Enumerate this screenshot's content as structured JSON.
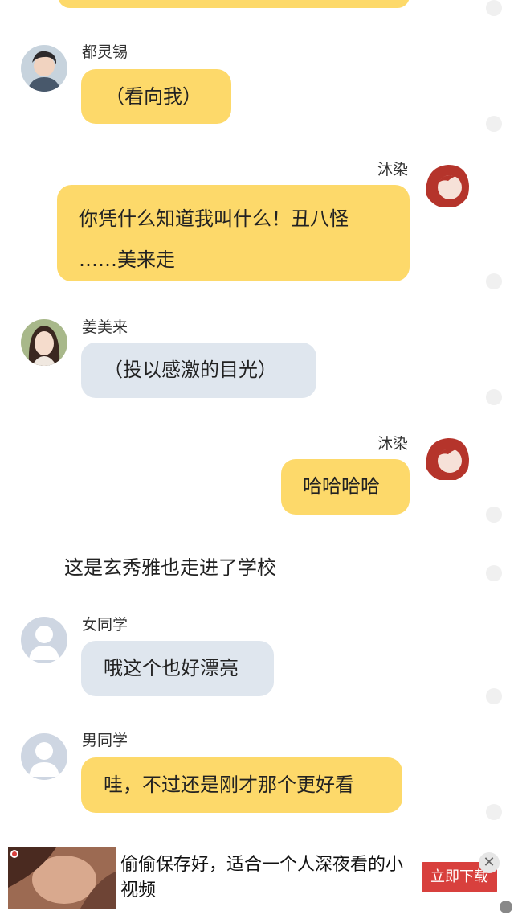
{
  "messages": [
    {
      "sender": "都灵锡",
      "side": "left",
      "text": "（看向我）",
      "color": "#fdd96a"
    },
    {
      "sender": "沐染",
      "side": "right",
      "text_line1": "你凭什么知道我叫什么！丑八怪",
      "text_line2": "……美来走",
      "color": "#fdd96a"
    },
    {
      "sender": "姜美来",
      "side": "left",
      "text": "（投以感激的目光）",
      "color": "#dfe6ee"
    },
    {
      "sender": "沐染",
      "side": "right",
      "text": "哈哈哈哈",
      "color": "#fdd96a"
    },
    {
      "sender": "女同学",
      "side": "left",
      "text": "哦这个也好漂亮",
      "color": "#dfe6ee"
    },
    {
      "sender": "男同学",
      "side": "left",
      "text": "哇，不过还是刚才那个更好看",
      "color": "#fdd96a"
    }
  ],
  "narration": "这是玄秀雅也走进了学校",
  "ad": {
    "text": "偷偷保存好，适合一个人深夜看的小视频",
    "button_label": "立即下载",
    "close_icon": "✕"
  },
  "colors": {
    "bubble_yellow": "#fdd96a",
    "bubble_grey": "#dfe6ee",
    "ad_button": "#d8403d"
  }
}
